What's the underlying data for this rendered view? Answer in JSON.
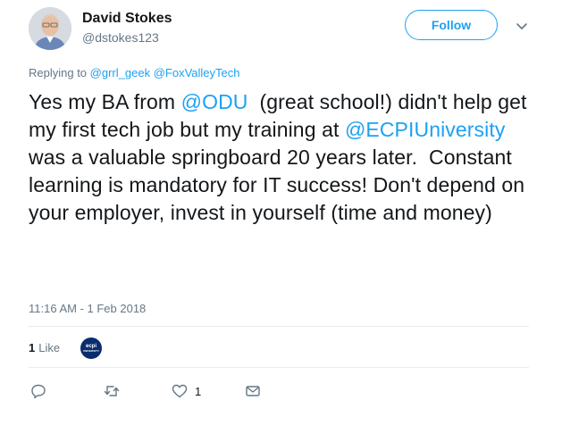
{
  "author": {
    "name": "David Stokes",
    "handle": "@dstokes123"
  },
  "follow_label": "Follow",
  "replying": {
    "prefix": "Replying to",
    "mentions": [
      "@grrl_geek",
      "@FoxValleyTech"
    ]
  },
  "tweet": {
    "segments": [
      {
        "text": "Yes my BA from ",
        "type": "text"
      },
      {
        "text": "@ODU",
        "type": "link"
      },
      {
        "text": "  (great school!) didn't help get my first tech job but my training at ",
        "type": "text"
      },
      {
        "text": "@ECPIUniversity",
        "type": "link"
      },
      {
        "text": " was a valuable springboard 20 years later.  Constant learning is mandatory for IT success! Don't depend on your employer, invest in yourself (time and money)",
        "type": "text"
      }
    ]
  },
  "timestamp": "11:16 AM - 1 Feb 2018",
  "likes": {
    "count": "1",
    "label": "Like",
    "liker_avatar_text": [
      "ecpi",
      "UNIVERSITY"
    ]
  },
  "actions": {
    "reply_count": "",
    "retweet_count": "",
    "like_count": "1",
    "message_count": ""
  },
  "colors": {
    "accent": "#1da1f2",
    "secondary_text": "#657786",
    "primary_text": "#14171a",
    "divider": "#e6ecf0"
  },
  "icons": {
    "reply": "reply-icon",
    "retweet": "retweet-icon",
    "like": "heart-icon",
    "message": "envelope-icon",
    "caret": "chevron-down-icon"
  }
}
